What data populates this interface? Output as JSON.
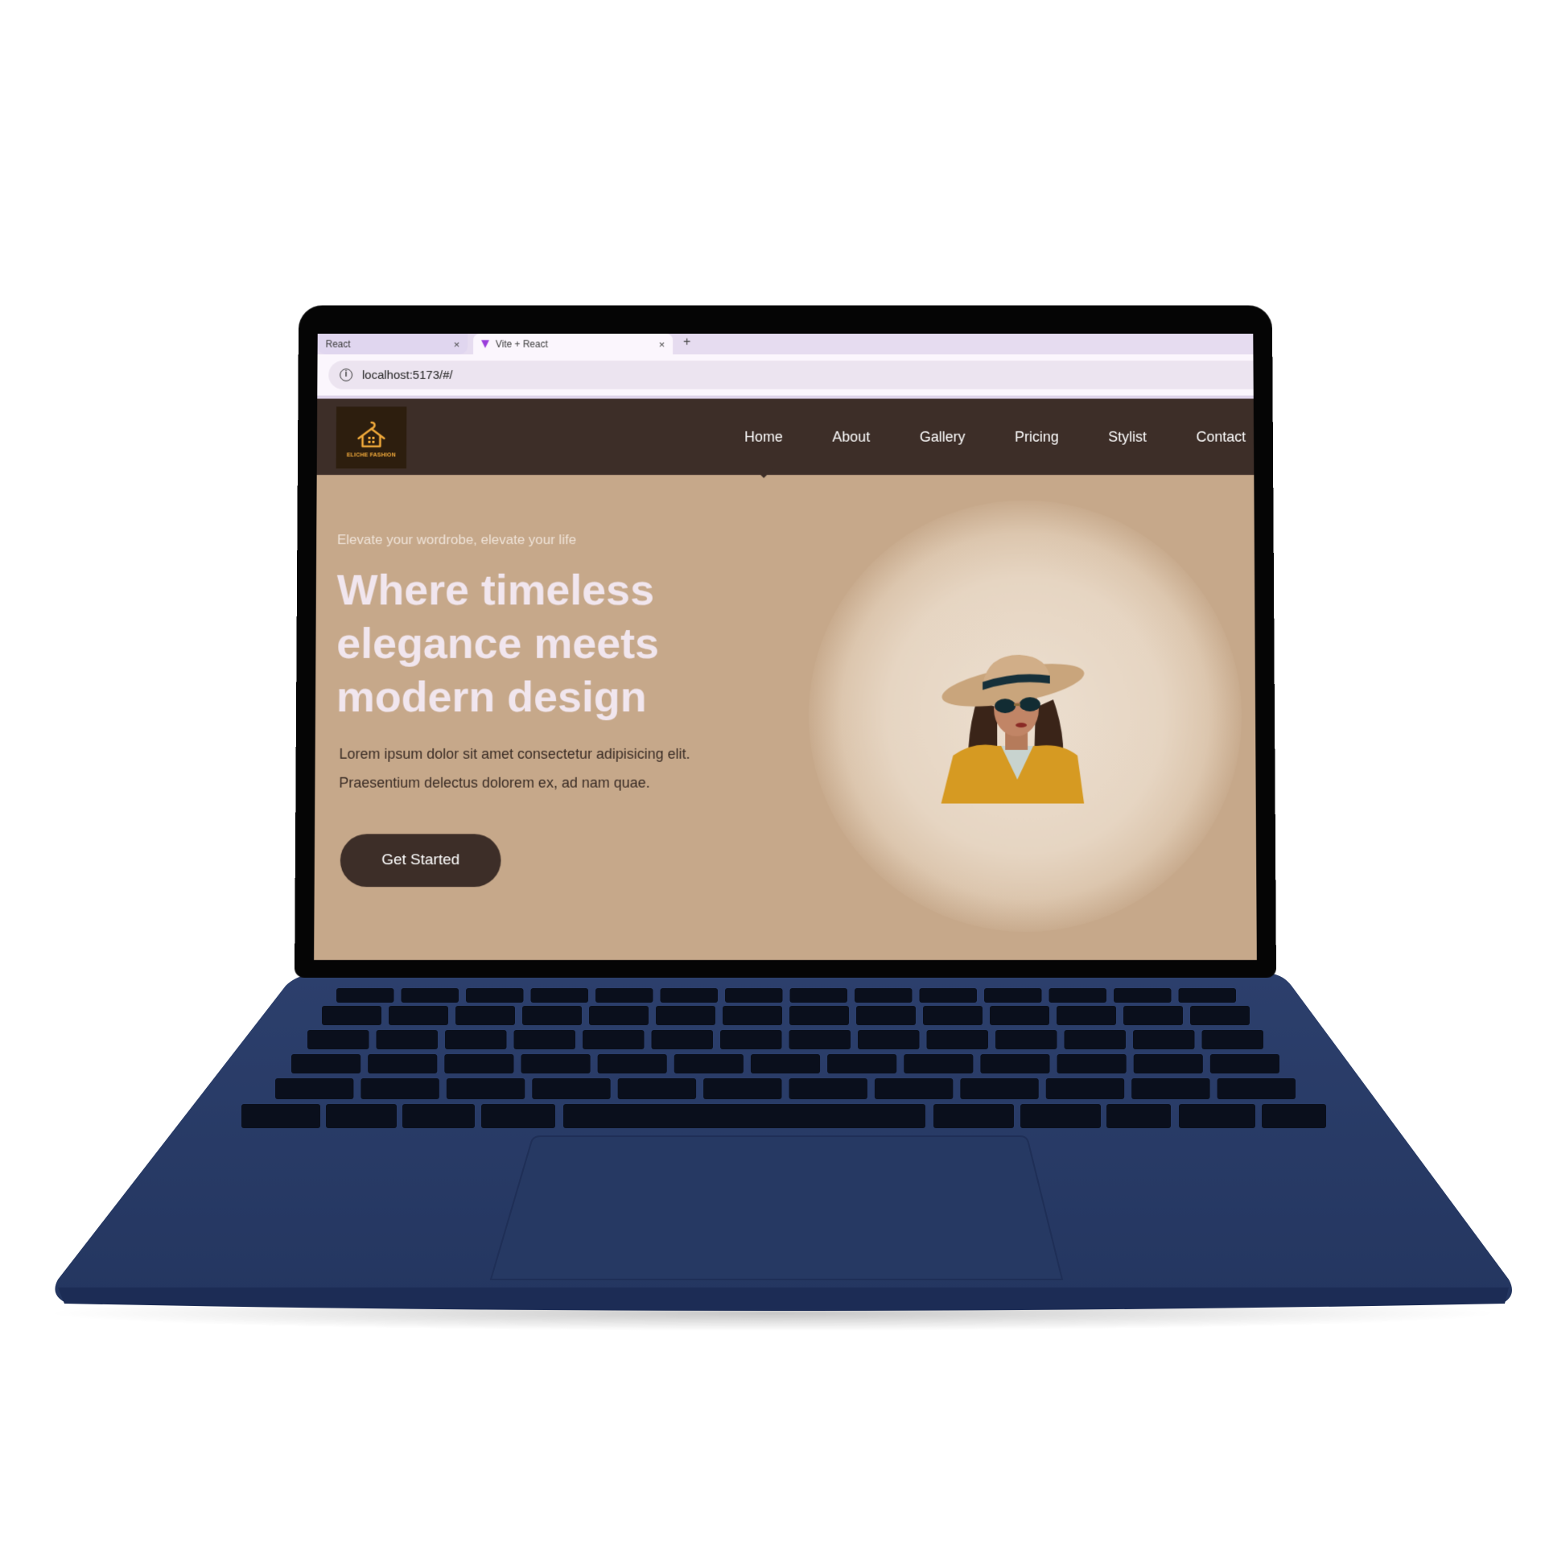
{
  "browser": {
    "tabs": [
      {
        "label": "React",
        "active": false
      },
      {
        "label": "Vite + React",
        "active": true
      }
    ],
    "close_glyph": "×",
    "new_tab_glyph": "+",
    "url": "localhost:5173/#/"
  },
  "site": {
    "logo_text": "ELICHE FASHION",
    "nav": [
      {
        "label": "Home",
        "active": true
      },
      {
        "label": "About"
      },
      {
        "label": "Gallery"
      },
      {
        "label": "Pricing"
      },
      {
        "label": "Stylist"
      },
      {
        "label": "Contact"
      }
    ],
    "hero": {
      "tagline": "Elevate your wordrobe, elevate your life",
      "headline": "Where timeless elegance meets modern design",
      "body": "Lorem ipsum dolor sit amet consectetur adipisicing elit. Praesentium delectus dolorem ex, ad nam quae.",
      "cta_label": "Get Started"
    }
  },
  "colors": {
    "nav_bg": "#3d2e28",
    "hero_bg": "#c6a88a",
    "laptop_body": "#273863",
    "keys": "#0a0f1c",
    "logo_accent": "#f0a93a"
  },
  "icons": [
    "info-icon",
    "hanger-house-logo-icon",
    "close-icon",
    "plus-icon",
    "vite-favicon-icon"
  ]
}
